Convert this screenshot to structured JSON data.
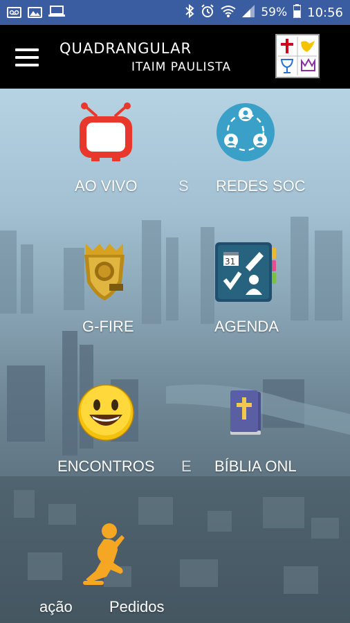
{
  "status_bar": {
    "battery": "59%",
    "time": "10:56",
    "icons": [
      "voicemail-icon",
      "image-icon",
      "laptop-icon",
      "bluetooth-icon",
      "alarm-icon",
      "wifi-icon",
      "signal-icon",
      "battery-icon"
    ]
  },
  "header": {
    "title_line1": "QUADRANGULAR",
    "title_line2": "ITAIM PAULISTA",
    "menu_icon": "hamburger-icon",
    "logo_icon": "quadrangular-logo-icon"
  },
  "menu": {
    "items": [
      {
        "label": "AO VIVO",
        "icon": "tv-icon"
      },
      {
        "label": "REDES SOC",
        "icon": "social-network-icon"
      },
      {
        "label": "G-FIRE",
        "icon": "crest-icon"
      },
      {
        "label": "AGENDA",
        "icon": "calendar-icon"
      },
      {
        "label": "ENCONTROS",
        "icon": "smiley-icon"
      },
      {
        "label": "BÍBLIA ONL",
        "icon": "bible-icon"
      },
      {
        "label": "ação",
        "icon": ""
      },
      {
        "label": "Pedidos",
        "icon": "praying-person-icon"
      }
    ],
    "ghost_labels": [
      "S",
      "E"
    ]
  },
  "colors": {
    "status_bar_bg": "#3a5ca0",
    "app_bar_bg": "#000000",
    "accent_orange": "#f5a623"
  }
}
